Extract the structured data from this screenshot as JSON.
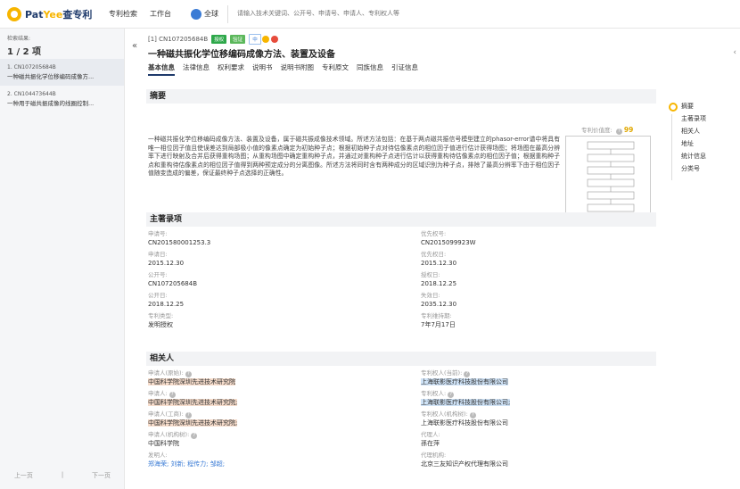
{
  "topbar": {
    "brand_a": "Pat",
    "brand_b": "Yee",
    "brand_c": "查专利",
    "nav": [
      "专利检索",
      "工作台"
    ],
    "scope": "全球",
    "search_placeholder": "请输入技术关键词、公开号、申请号、申请人、专利权人等"
  },
  "left": {
    "header": "检索结果:",
    "count": "1 / 2 项",
    "results": [
      {
        "no": "1. CN107205684B",
        "title": "一种磁共振化学位移编码成像方...",
        "active": true
      },
      {
        "no": "2. CN104473644B",
        "title": "一种用于磁共振成像的线圈控制...",
        "active": false
      }
    ],
    "prev": "上一页",
    "sep": "|",
    "next": "下一页"
  },
  "main": {
    "pn": "[1] CN107205684B",
    "tags": [
      "授权",
      "验证",
      "中"
    ],
    "title": "一种磁共振化学位移编码成像方法、装置及设备",
    "tabs": [
      "基本信息",
      "法律信息",
      "权利要求",
      "说明书",
      "说明书附图",
      "专利原文",
      "同族信息",
      "引证信息"
    ],
    "abstract_title": "摘要",
    "score_label": "专利价值度:",
    "score_value": "99",
    "abstract": "一种磁共振化学位移编码成像方法、装置及设备，属于磁共振成像技术领域。所述方法包括：在基于两点磁共振信号模型建立的phasor-error谱中将具有唯一相位因子值且使误差达到局部极小值的像素点确定为初始种子点；根据初始种子点对待估像素点的相位因子值进行估计获得场图；将场图在最高分辨率下进行映射及合并后获得重构场图；从重构场图中确定重构种子点，并通过对重构种子点进行估计以获得重构待估像素点的相位因子值；根据重构种子点和重构待估像素点的相位因子值得到两种预定成分的分离图像。所述方法将同时含有两种成分的区域识别为种子点，排除了最高分辨率下由于相位因子值随变造成的偏差，保证最终种子点选择的正确性。",
    "biblio_title": "主著录项",
    "biblio": [
      {
        "k": "申请号:",
        "v": "CN201580001253.3"
      },
      {
        "k": "优先权号:",
        "v": "CN2015099923W"
      },
      {
        "k": "申请日:",
        "v": "2015.12.30"
      },
      {
        "k": "优先权日:",
        "v": "2015.12.30"
      },
      {
        "k": "公开号:",
        "v": "CN107205684B"
      },
      {
        "k": "授权日:",
        "v": "2018.12.25"
      },
      {
        "k": "公开日:",
        "v": "2018.12.25"
      },
      {
        "k": "失效日:",
        "v": "2035.12.30"
      },
      {
        "k": "专利类型:",
        "v": "发明授权"
      },
      {
        "k": "专利维持期:",
        "v": "7年7月17日"
      }
    ],
    "parties_title": "相关人",
    "parties": [
      {
        "k": "申请人(原始):",
        "v": "中国科学院深圳先进技术研究院"
      },
      {
        "k": "专利权人(当前):",
        "v": "上海联影医疗科技股份有限公司"
      },
      {
        "k": "申请人:",
        "v": "中国科学院深圳先进技术研究院;"
      },
      {
        "k": "专利权人:",
        "v": "上海联影医疗科技股份有限公司;"
      },
      {
        "k": "申请人(工商):",
        "v": "中国科学院深圳先进技术研究院;"
      },
      {
        "k": "专利权人(机构树):",
        "v": "上海联影医疗科技股份有限公司"
      },
      {
        "k": "申请人(机构树):",
        "v": "中国科学院"
      },
      {
        "k": "代理人:",
        "v": "孫在萍"
      },
      {
        "k": "发明人:",
        "v": "郑海荣; 刘新; 程传力; 邹超;"
      },
      {
        "k": "代理机构:",
        "v": "北京三友知识产权代理有限公司"
      }
    ]
  },
  "right": {
    "items": [
      "摘要",
      "主著录项",
      "相关人",
      "地址",
      "统计信息",
      "分类号"
    ]
  },
  "colors": {
    "accent": "#f7b500",
    "brand": "#1e3a6b"
  }
}
